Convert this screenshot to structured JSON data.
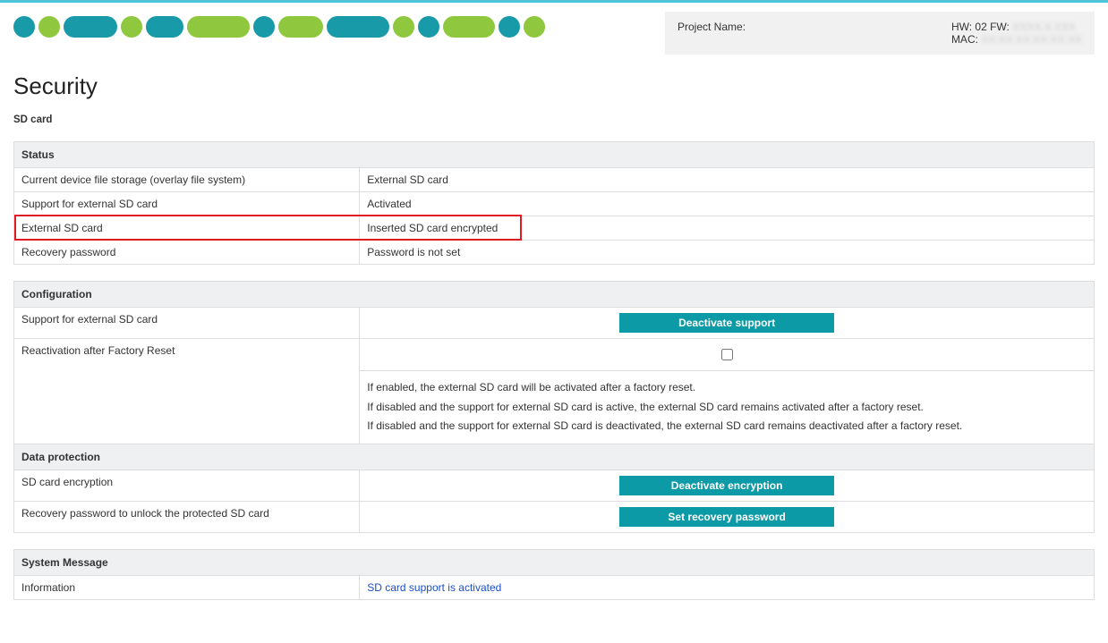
{
  "header": {
    "project_label": "Project Name:",
    "hw_label": "HW:",
    "hw_value": "02",
    "fw_label": "FW:",
    "fw_value": "XXXX.X.XXX",
    "mac_label": "MAC:",
    "mac_value": "XX:XX:XX:XX:XX:XX"
  },
  "page": {
    "title": "Security",
    "subtitle": "SD card"
  },
  "status": {
    "head": "Status",
    "rows": [
      {
        "label": "Current device file storage (overlay file system)",
        "value": "External SD card"
      },
      {
        "label": "Support for external SD card",
        "value": "Activated"
      },
      {
        "label": "External SD card",
        "value": "Inserted SD card encrypted"
      },
      {
        "label": "Recovery password",
        "value": "Password is not set"
      }
    ]
  },
  "config": {
    "head": "Configuration",
    "support_label": "Support for external SD card",
    "deactivate_support_btn": "Deactivate support",
    "reactivation_label": "Reactivation after Factory Reset",
    "desc_line1": "If enabled, the external SD card will be activated after a factory reset.",
    "desc_line2": "If disabled and the support for external SD card is active, the external SD card remains activated after a factory reset.",
    "desc_line3": "If disabled and the support for external SD card is deactivated, the external SD card remains deactivated after a factory reset."
  },
  "data_protection": {
    "head": "Data protection",
    "encryption_label": "SD card encryption",
    "deactivate_encryption_btn": "Deactivate encryption",
    "recovery_label": "Recovery password to unlock the protected SD card",
    "set_recovery_btn": "Set recovery password"
  },
  "system_msg": {
    "head": "System Message",
    "info_label": "Information",
    "info_value": "SD card support is activated"
  }
}
